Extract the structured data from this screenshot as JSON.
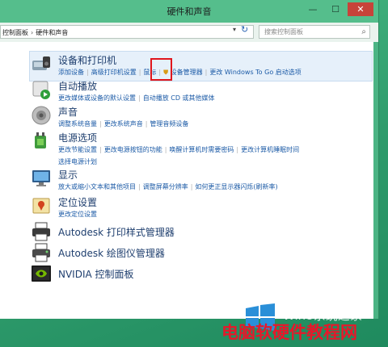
{
  "window": {
    "title": "硬件和声音",
    "min_label": "—",
    "max_label": "☐",
    "close_label": "✕"
  },
  "address": {
    "crumb_root": "控制面板",
    "crumb_current": "硬件和声音",
    "search_placeholder": "搜索控制面板"
  },
  "categories": [
    {
      "title": "设备和打印机",
      "links": [
        "添加设备",
        "高级打印机设置",
        "鼠标",
        "设备管理器",
        "更改 Windows To Go 启动选项"
      ],
      "selected": true
    },
    {
      "title": "自动播放",
      "links": [
        "更改媒体或设备的默认设置",
        "自动播放 CD 或其他媒体"
      ]
    },
    {
      "title": "声音",
      "links": [
        "调整系统音量",
        "更改系统声音",
        "管理音频设备"
      ]
    },
    {
      "title": "电源选项",
      "links": [
        "更改节能设置",
        "更改电源按钮的功能",
        "唤醒计算机时需要密码",
        "更改计算机睡眠时间"
      ],
      "links_line2": [
        "选择电源计划"
      ]
    },
    {
      "title": "显示",
      "links": [
        "放大或缩小文本和其他项目",
        "调整屏幕分辨率",
        "如何更正显示器闪烁(刷新率)"
      ]
    },
    {
      "title": "定位设置",
      "links": [
        "更改定位设置"
      ]
    },
    {
      "title": "Autodesk 打印样式管理器",
      "links": []
    },
    {
      "title": "Autodesk 绘图仪管理器",
      "links": []
    },
    {
      "title": "NVIDIA 控制面板",
      "links": []
    }
  ],
  "watermark": {
    "line1": "Win8系统之家",
    "line2": "电脑软硬件教程网"
  },
  "colors": {
    "desktop": "#3fae7c",
    "titlebar": "#55be8c",
    "link": "#1b5aa6",
    "highlight": "#e0161c"
  }
}
